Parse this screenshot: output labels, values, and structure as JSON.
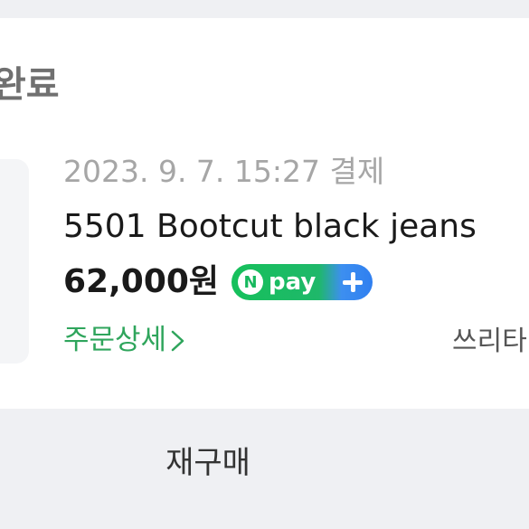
{
  "header": {
    "status_title": "완료"
  },
  "order": {
    "date": "2023. 9. 7. 15:27 결제",
    "product_name": "5501 Bootcut black jeans",
    "price": "62,000원",
    "payment_badge": {
      "logo_letter": "N",
      "label": "pay",
      "icon": "plus-icon",
      "colors": {
        "start": "#16c05b",
        "end": "#2f7ff0"
      }
    },
    "detail_link": "주문상세",
    "seller": "쓰리타"
  },
  "actions": {
    "reorder_label": "재구매"
  },
  "colors": {
    "link_green": "#2fa55c",
    "bar_gray": "#eff0f3"
  }
}
